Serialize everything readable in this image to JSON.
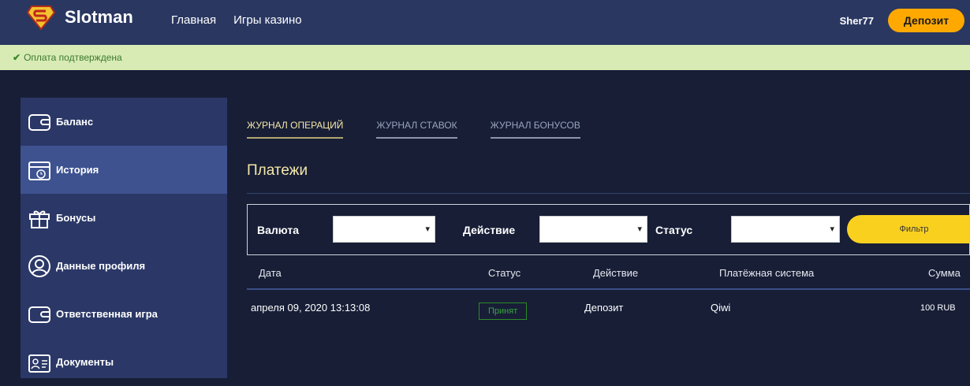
{
  "header": {
    "brand": "Slotman",
    "nav": [
      "Главная",
      "Игры казино"
    ],
    "username": "Sher77",
    "deposit_label": "Депозит"
  },
  "alert": {
    "text": "Оплата подтверждена",
    "color": "#3c7a2e"
  },
  "sidebar": {
    "items": [
      {
        "label": "Баланс",
        "icon": "wallet-icon"
      },
      {
        "label": "История",
        "icon": "calendar-clock-icon"
      },
      {
        "label": "Бонусы",
        "icon": "gift-icon"
      },
      {
        "label": "Данные профиля",
        "icon": "user-icon"
      },
      {
        "label": "Ответственная игра",
        "icon": "wallet-icon"
      },
      {
        "label": "Документы",
        "icon": "id-card-icon"
      }
    ],
    "active": "История"
  },
  "main": {
    "tabs": [
      "ЖУРНАЛ ОПЕРАЦИЙ",
      "ЖУРНАЛ СТАВОК",
      "ЖУРНАЛ БОНУСОВ"
    ],
    "title": "Платежи",
    "filter": {
      "currency_label": "Валюта",
      "currency_value": "",
      "action_label": "Действие",
      "action_value": "",
      "status_label": "Статус",
      "status_value": "",
      "button": "Фильтр"
    },
    "table": {
      "headers": [
        "Дата",
        "Статус",
        "Действие",
        "Платёжная система",
        "Сумма"
      ],
      "rows": [
        {
          "date": "апреля 09, 2020 13:13:08",
          "status": "Принят",
          "action": "Депозит",
          "system": "Qiwi",
          "amount": "100 RUB"
        }
      ]
    }
  }
}
